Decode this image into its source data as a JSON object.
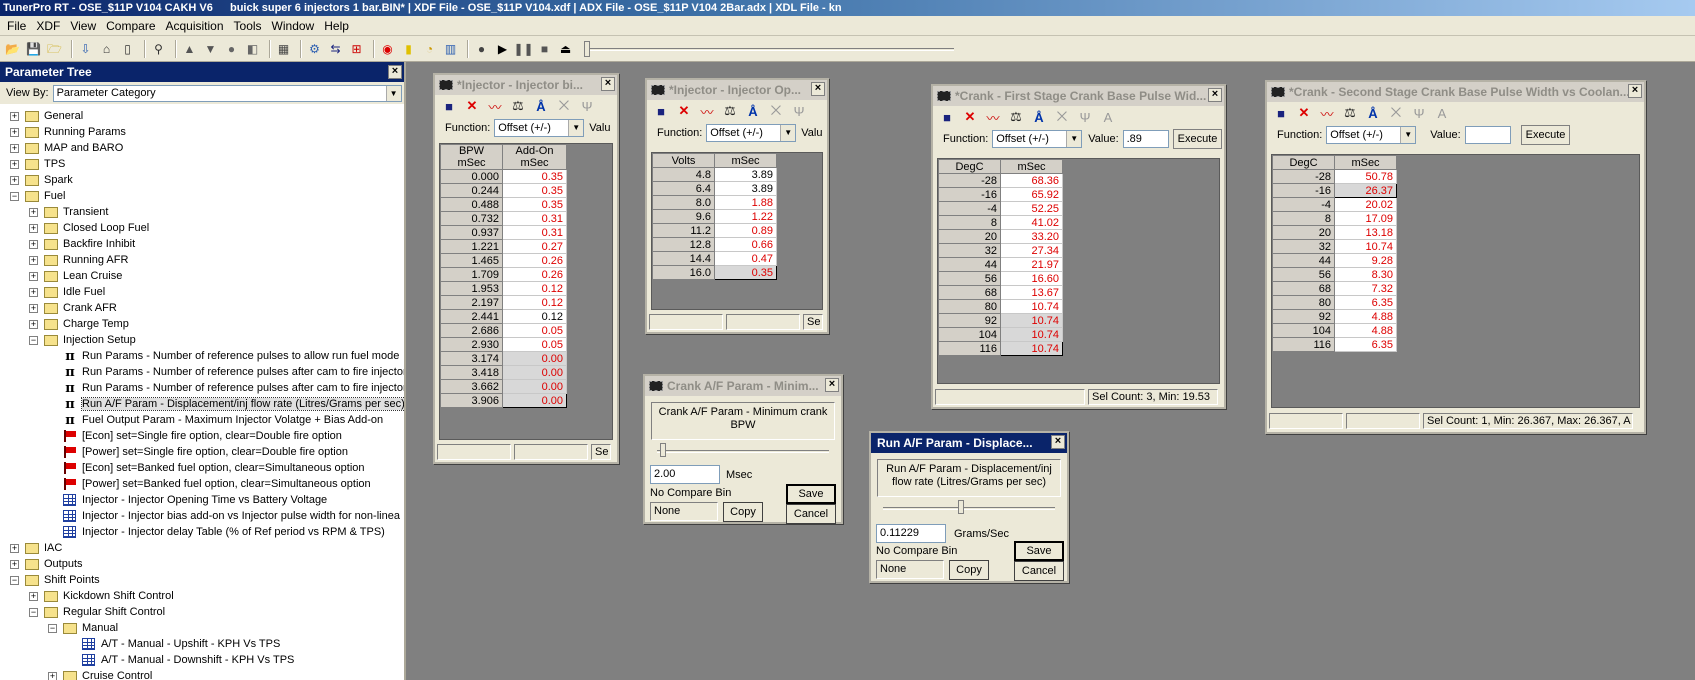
{
  "title_bar": {
    "app": "TunerPro RT - OSE_$11P V104 CAKH V6",
    "file": "buick super 6 injectors 1 bar.BIN* | XDF File - OSE_$11P V104.xdf | ADX File - OSE_$11P V104 2Bar.adx | XDL File - kn"
  },
  "menu": [
    "File",
    "XDF",
    "View",
    "Compare",
    "Acquisition",
    "Tools",
    "Window",
    "Help"
  ],
  "tree": {
    "title": "Parameter Tree",
    "view_by_label": "View By:",
    "view_by_value": "Parameter Category",
    "items": [
      {
        "label": "General",
        "type": "folder",
        "level": 0,
        "exp": "+"
      },
      {
        "label": "Running Params",
        "type": "folder",
        "level": 0,
        "exp": "+"
      },
      {
        "label": "MAP and BARO",
        "type": "folder",
        "level": 0,
        "exp": "+"
      },
      {
        "label": "TPS",
        "type": "folder",
        "level": 0,
        "exp": "+"
      },
      {
        "label": "Spark",
        "type": "folder",
        "level": 0,
        "exp": "+"
      },
      {
        "label": "Fuel",
        "type": "folder",
        "level": 0,
        "exp": "−"
      },
      {
        "label": "Transient",
        "type": "folder",
        "level": 1,
        "exp": "+"
      },
      {
        "label": "Closed Loop Fuel",
        "type": "folder",
        "level": 1,
        "exp": "+"
      },
      {
        "label": "Backfire Inhibit",
        "type": "folder",
        "level": 1,
        "exp": "+"
      },
      {
        "label": "Running AFR",
        "type": "folder",
        "level": 1,
        "exp": "+"
      },
      {
        "label": "Lean Cruise",
        "type": "folder",
        "level": 1,
        "exp": "+"
      },
      {
        "label": "Idle Fuel",
        "type": "folder",
        "level": 1,
        "exp": "+"
      },
      {
        "label": "Crank AFR",
        "type": "folder",
        "level": 1,
        "exp": "+"
      },
      {
        "label": "Charge Temp",
        "type": "folder",
        "level": 1,
        "exp": "+"
      },
      {
        "label": "Injection Setup",
        "type": "folder",
        "level": 1,
        "exp": "−"
      },
      {
        "label": "Run Params - Number of reference pulses to allow run fuel mode",
        "type": "pi",
        "level": 2
      },
      {
        "label": "Run Params - Number of reference pulses after cam to fire injector",
        "type": "pi",
        "level": 2
      },
      {
        "label": "Run Params - Number of reference pulses after cam to fire injector",
        "type": "pi",
        "level": 2
      },
      {
        "label": "Run A/F Param - Displacement/inj flow rate (Litres/Grams per sec)",
        "type": "pi",
        "level": 2,
        "selected": true
      },
      {
        "label": "Fuel Output Param - Maximum Injector Volatge + Bias Add-on",
        "type": "pi",
        "level": 2
      },
      {
        "label": "[Econ] set=Single fire option, clear=Double fire option",
        "type": "flag",
        "level": 2
      },
      {
        "label": "[Power] set=Single fire option, clear=Double fire option",
        "type": "flag",
        "level": 2
      },
      {
        "label": "[Econ] set=Banked fuel option, clear=Simultaneous option",
        "type": "flag",
        "level": 2
      },
      {
        "label": "[Power] set=Banked fuel option, clear=Simultaneous option",
        "type": "flag",
        "level": 2
      },
      {
        "label": "Injector - Injector Opening Time vs Battery Voltage",
        "type": "grid",
        "level": 2
      },
      {
        "label": "Injector - Injector bias add-on vs Injector pulse width for non-linea",
        "type": "grid",
        "level": 2
      },
      {
        "label": "Injector - Injector delay Table (% of Ref period vs RPM & TPS)",
        "type": "grid",
        "level": 2
      },
      {
        "label": "IAC",
        "type": "folder",
        "level": 0,
        "exp": "+"
      },
      {
        "label": "Outputs",
        "type": "folder",
        "level": 0,
        "exp": "+"
      },
      {
        "label": "Shift Points",
        "type": "folder",
        "level": 0,
        "exp": "−"
      },
      {
        "label": "Kickdown Shift Control",
        "type": "folder",
        "level": 1,
        "exp": "+"
      },
      {
        "label": "Regular Shift Control",
        "type": "folder",
        "level": 1,
        "exp": "−"
      },
      {
        "label": "Manual",
        "type": "folder",
        "level": 2,
        "exp": "−"
      },
      {
        "label": "A/T - Manual - Upshift - KPH Vs TPS",
        "type": "grid",
        "level": 3
      },
      {
        "label": "A/T - Manual - Downshift - KPH Vs TPS",
        "type": "grid",
        "level": 3
      },
      {
        "label": "Cruise Control",
        "type": "folder",
        "level": 2,
        "exp": "+"
      }
    ]
  },
  "win_bias": {
    "title": "*Injector - Injector bi...",
    "function_label": "Function:",
    "function_value": "Offset (+/-)",
    "value_label": "Valu",
    "headers": [
      "BPW mSec",
      "Add-On mSec"
    ],
    "rows": [
      {
        "k": "0.000",
        "v": "0.35"
      },
      {
        "k": "0.244",
        "v": "0.35"
      },
      {
        "k": "0.488",
        "v": "0.35"
      },
      {
        "k": "0.732",
        "v": "0.31"
      },
      {
        "k": "0.937",
        "v": "0.31"
      },
      {
        "k": "1.221",
        "v": "0.27"
      },
      {
        "k": "1.465",
        "v": "0.26"
      },
      {
        "k": "1.709",
        "v": "0.26"
      },
      {
        "k": "1.953",
        "v": "0.12"
      },
      {
        "k": "2.197",
        "v": "0.12"
      },
      {
        "k": "2.441",
        "v": "0.12",
        "black": true
      },
      {
        "k": "2.686",
        "v": "0.05"
      },
      {
        "k": "2.930",
        "v": "0.05"
      },
      {
        "k": "3.174",
        "v": "0.00",
        "gray": true
      },
      {
        "k": "3.418",
        "v": "0.00",
        "gray": true
      },
      {
        "k": "3.662",
        "v": "0.00",
        "gray": true
      },
      {
        "k": "3.906",
        "v": "0.00",
        "gray": true,
        "sel": true
      }
    ],
    "status": [
      "",
      "",
      "Se"
    ]
  },
  "win_open": {
    "title": "*Injector - Injector Op...",
    "function_label": "Function:",
    "function_value": "Offset (+/-)",
    "value_label": "Valu",
    "headers": [
      "Volts",
      "mSec"
    ],
    "rows": [
      {
        "k": "4.8",
        "v": "3.89",
        "black": true
      },
      {
        "k": "6.4",
        "v": "3.89",
        "black": true
      },
      {
        "k": "8.0",
        "v": "1.88"
      },
      {
        "k": "9.6",
        "v": "1.22"
      },
      {
        "k": "11.2",
        "v": "0.89"
      },
      {
        "k": "12.8",
        "v": "0.66"
      },
      {
        "k": "14.4",
        "v": "0.47"
      },
      {
        "k": "16.0",
        "v": "0.35",
        "gray": true,
        "sel": true
      }
    ],
    "status": [
      "",
      "",
      "Se"
    ]
  },
  "win_crank1": {
    "title": "*Crank - First Stage Crank Base Pulse Wid...",
    "function_label": "Function:",
    "function_value": "Offset (+/-)",
    "value_label": "Value:",
    "value_input": ".89",
    "execute": "Execute",
    "headers": [
      "DegC",
      "mSec"
    ],
    "rows": [
      {
        "k": "-28",
        "v": "68.36"
      },
      {
        "k": "-16",
        "v": "65.92"
      },
      {
        "k": "-4",
        "v": "52.25"
      },
      {
        "k": "8",
        "v": "41.02"
      },
      {
        "k": "20",
        "v": "33.20"
      },
      {
        "k": "32",
        "v": "27.34"
      },
      {
        "k": "44",
        "v": "21.97"
      },
      {
        "k": "56",
        "v": "16.60"
      },
      {
        "k": "68",
        "v": "13.67"
      },
      {
        "k": "80",
        "v": "10.74"
      },
      {
        "k": "92",
        "v": "10.74",
        "gray": true
      },
      {
        "k": "104",
        "v": "10.74",
        "gray": true
      },
      {
        "k": "116",
        "v": "10.74",
        "gray": true,
        "sel": true
      }
    ],
    "status": [
      "",
      "Sel Count: 3, Min: 19.53"
    ]
  },
  "win_crank2": {
    "title": "*Crank - Second Stage Crank Base Pulse Width vs Coolan...",
    "function_label": "Function:",
    "function_value": "Offset (+/-)",
    "value_label": "Value:",
    "value_input": "",
    "execute": "Execute",
    "headers": [
      "DegC",
      "mSec"
    ],
    "rows": [
      {
        "k": "-28",
        "v": "50.78"
      },
      {
        "k": "-16",
        "v": "26.37",
        "gray": true,
        "sel": true
      },
      {
        "k": "-4",
        "v": "20.02"
      },
      {
        "k": "8",
        "v": "17.09"
      },
      {
        "k": "20",
        "v": "13.18"
      },
      {
        "k": "32",
        "v": "10.74"
      },
      {
        "k": "44",
        "v": "9.28"
      },
      {
        "k": "56",
        "v": "8.30"
      },
      {
        "k": "68",
        "v": "7.32"
      },
      {
        "k": "80",
        "v": "6.35"
      },
      {
        "k": "92",
        "v": "4.88"
      },
      {
        "k": "104",
        "v": "4.88"
      },
      {
        "k": "116",
        "v": "6.35"
      }
    ],
    "status": [
      "",
      "",
      "Sel Count: 1, Min: 26.367, Max: 26.367, A"
    ]
  },
  "win_crankaf": {
    "title": "Crank A/F Param - Minim...",
    "label": "Crank A/F Param - Minimum crank BPW",
    "slider": 0.02,
    "value": "2.00",
    "unit": "Msec",
    "compare_label": "No Compare Bin",
    "compare_value": "None",
    "copy": "Copy",
    "save": "Save",
    "cancel": "Cancel"
  },
  "win_runaf": {
    "title": "Run A/F Param - Displace...",
    "label": "Run A/F Param - Displacement/inj flow rate (Litres/Grams per sec)",
    "slider": 0.45,
    "value": "0.11229",
    "unit": "Grams/Sec",
    "compare_label": "No Compare Bin",
    "compare_value": "None",
    "copy": "Copy",
    "save": "Save",
    "cancel": "Cancel"
  }
}
